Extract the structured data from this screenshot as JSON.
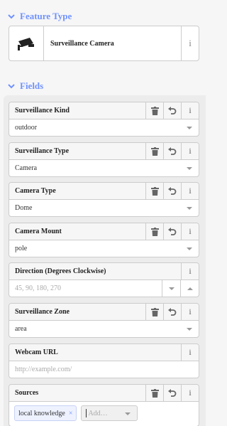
{
  "feature_type": {
    "header": "Feature Type",
    "preset_name": "Surveillance Camera",
    "info_icon": "info-icon",
    "preset_icon": "surveillance-camera-icon"
  },
  "fields_section": {
    "header": "Fields",
    "fields": [
      {
        "label": "Surveillance Kind",
        "value": "outdoor",
        "placeholder": ""
      },
      {
        "label": "Surveillance Type",
        "value": "Camera",
        "placeholder": ""
      },
      {
        "label": "Camera Type",
        "value": "Dome",
        "placeholder": ""
      },
      {
        "label": "Camera Mount",
        "value": "pole",
        "placeholder": ""
      },
      {
        "label": "Direction (Degrees Clockwise)",
        "value": "",
        "placeholder": "45, 90, 180, 270"
      },
      {
        "label": "Surveillance Zone",
        "value": "area",
        "placeholder": ""
      },
      {
        "label": "Webcam URL",
        "value": "",
        "placeholder": "http://example.com/"
      },
      {
        "label": "Sources",
        "chip": "local knowledge",
        "add_placeholder": "Add…"
      }
    ]
  },
  "icons": {
    "delete": "trash-icon",
    "undo": "undo-icon",
    "info": "info-icon",
    "caret": "chevron-down-icon"
  },
  "colors": {
    "accent": "#7092ff",
    "border": "#cccccc"
  }
}
